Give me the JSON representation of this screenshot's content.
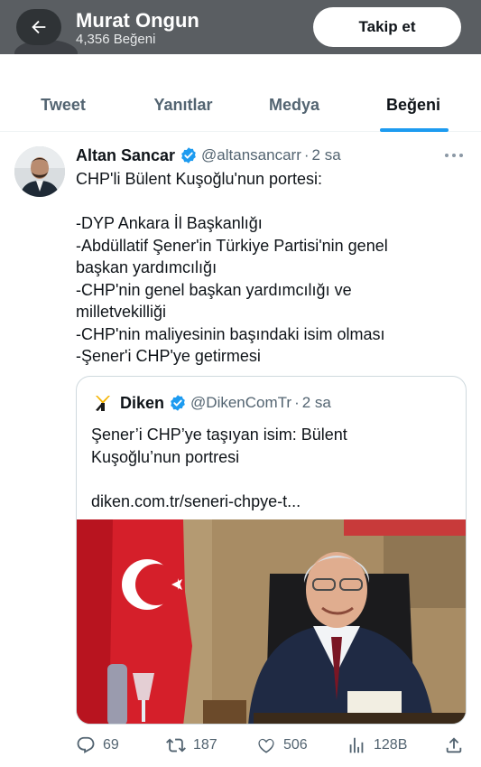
{
  "header": {
    "name": "Murat Ongun",
    "subtitle": "4,356 Beğeni",
    "follow_label": "Takip et"
  },
  "tabs": [
    {
      "label": "Tweet",
      "active": false
    },
    {
      "label": "Yanıtlar",
      "active": false
    },
    {
      "label": "Medya",
      "active": false
    },
    {
      "label": "Beğeni",
      "active": true
    }
  ],
  "tweet": {
    "author": "Altan Sancar",
    "handle": "@altansancarr",
    "separator": "·",
    "time": "2 sa",
    "lines": [
      "CHP'li Bülent Kuşoğlu'nun portesi:",
      "",
      "-DYP Ankara İl Başkanlığı",
      "-Abdüllatif Şener'in Türkiye Partisi'nin genel",
      "başkan yardımcılığı",
      "-CHP'nin genel başkan yardımcılığı ve",
      "milletvekilliği",
      "-CHP'nin maliyesinin başındaki isim olması",
      "-Şener'i CHP'ye getirmesi"
    ],
    "quote": {
      "author": "Diken",
      "handle": "@DikenComTr",
      "separator": "·",
      "time": "2 sa",
      "lines": [
        "Şener’i CHP’ye taşıyan isim: Bülent",
        "Kuşoğlu’nun portresi",
        "",
        "diken.com.tr/seneri-chpye-t..."
      ]
    },
    "stats": {
      "replies": "69",
      "retweets": "187",
      "likes": "506",
      "views": "128B"
    }
  },
  "colors": {
    "accent": "#1d9bf0",
    "text": "#0f1419",
    "muted": "#536471",
    "header_bg": "#5a5e62"
  },
  "icons": [
    "back-arrow-icon",
    "verified-badge-icon",
    "more-icon",
    "reply-icon",
    "retweet-icon",
    "like-icon",
    "views-icon",
    "share-icon"
  ]
}
